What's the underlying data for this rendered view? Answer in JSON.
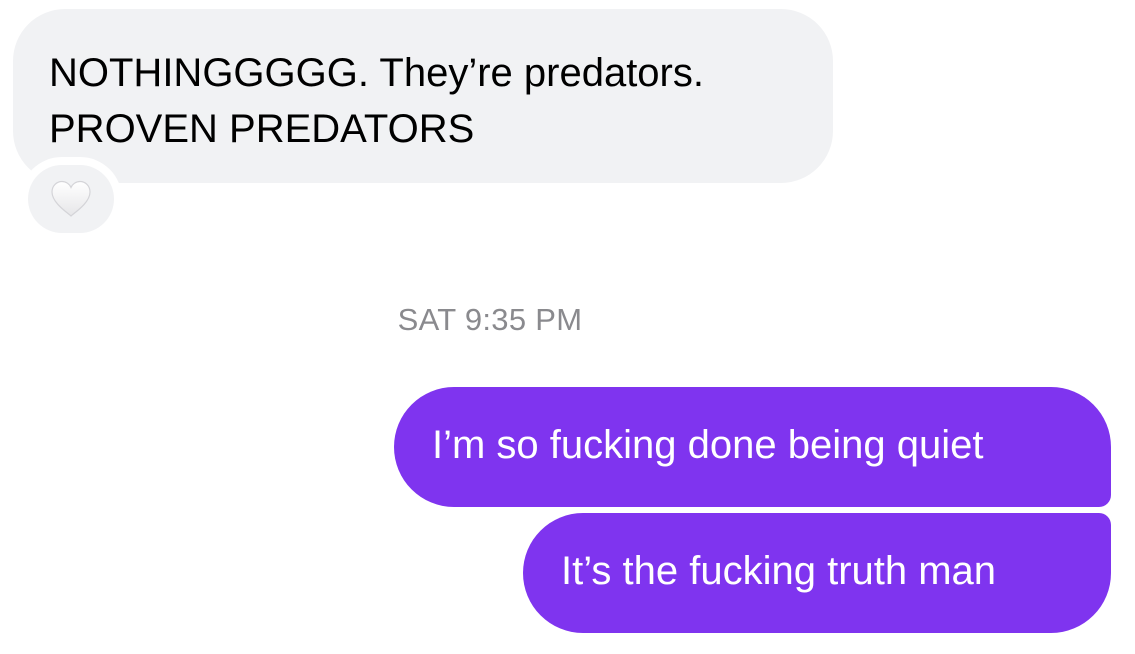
{
  "conversation": {
    "received": {
      "text": "NOTHINGGGGG. They’re predators.\nPROVEN PREDATORS",
      "reaction": {
        "icon": "white-heart-icon",
        "color": "#ffffff"
      }
    },
    "timestamp": "SAT 9:35 PM",
    "sent": [
      {
        "text": "I’m so fucking done being quiet"
      },
      {
        "text": "It’s the fucking truth man"
      }
    ]
  },
  "colors": {
    "received_bubble": "#f1f2f4",
    "sent_bubble": "#7f34ef",
    "timestamp": "#8a8a8e"
  }
}
